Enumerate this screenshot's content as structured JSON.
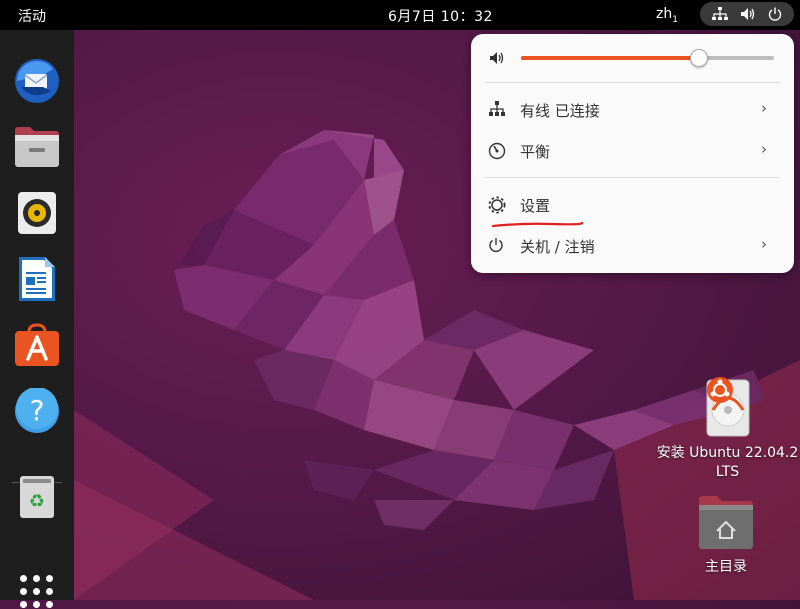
{
  "topbar": {
    "activities": "活动",
    "clock": "6月7日  10：32",
    "input_method": "zh",
    "input_method_sub": "1"
  },
  "dock": {
    "items": [
      {
        "icon": "thunderbird-icon"
      },
      {
        "icon": "files-icon"
      },
      {
        "icon": "rhythmbox-icon"
      },
      {
        "icon": "libreoffice-writer-icon"
      },
      {
        "icon": "ubuntu-software-icon"
      },
      {
        "icon": "help-icon"
      },
      {
        "icon": "trash-icon"
      }
    ],
    "apps_icon": "show-apps-icon"
  },
  "system_menu": {
    "volume_percent": 70,
    "items": [
      {
        "label": "有线 已连接",
        "icon": "wired-network-icon",
        "has_submenu": true
      },
      {
        "label": "平衡",
        "icon": "power-profile-icon",
        "has_submenu": true
      },
      {
        "label": "设置",
        "icon": "settings-icon",
        "has_submenu": false
      },
      {
        "label": "关机 / 注销",
        "icon": "power-icon",
        "has_submenu": true
      }
    ],
    "chevron": "›"
  },
  "desktop": {
    "install_label": "安装 Ubuntu 22.04.2 LTS",
    "install_label_line1": "安装 Ubuntu 22.04.2",
    "install_label_line2": "LTS",
    "home_label": "主目录"
  },
  "colors": {
    "accent": "#e95420",
    "annotation": "#e02020",
    "panel": "#000000",
    "dock": "#1e1e1e"
  }
}
